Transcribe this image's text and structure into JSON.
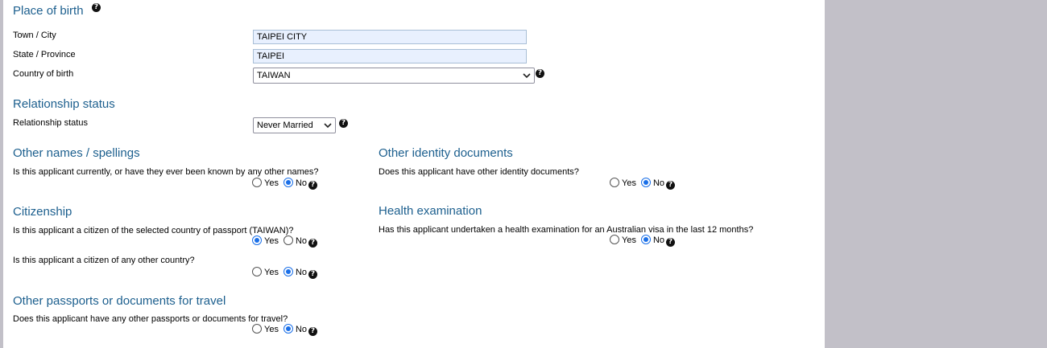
{
  "place_of_birth": {
    "heading": "Place of birth",
    "town_label": "Town / City",
    "town_value": "TAIPEI CITY",
    "state_label": "State / Province",
    "state_value": "TAIPEI",
    "country_label": "Country of birth",
    "country_value": "TAIWAN"
  },
  "relationship": {
    "heading": "Relationship status",
    "label": "Relationship status",
    "value": "Never Married"
  },
  "other_names": {
    "heading": "Other names / spellings",
    "question": "Is this applicant currently, or have they ever been known by any other names?",
    "yes": "Yes",
    "no": "No",
    "selected": "No"
  },
  "identity_docs": {
    "heading": "Other identity documents",
    "question": "Does this applicant have other identity documents?",
    "yes": "Yes",
    "no": "No",
    "selected": "No"
  },
  "citizenship": {
    "heading": "Citizenship",
    "q1": "Is this applicant a citizen of the selected country of passport (TAIWAN)?",
    "q1_selected": "Yes",
    "q2": "Is this applicant a citizen of any other country?",
    "q2_selected": "No",
    "yes": "Yes",
    "no": "No"
  },
  "health": {
    "heading": "Health examination",
    "question": "Has this applicant undertaken a health examination for an Australian visa in the last 12 months?",
    "yes": "Yes",
    "no": "No",
    "selected": "No"
  },
  "passports": {
    "heading": "Other passports or documents for travel",
    "question": "Does this applicant have any other passports or documents for travel?",
    "yes": "Yes",
    "no": "No",
    "selected": "No"
  },
  "icons": {
    "help": "?",
    "help_icon_name": "question-circle-icon",
    "chevron_icon_name": "chevron-down-icon"
  },
  "colors": {
    "heading": "#1c5f8e",
    "field_bg": "#e8f0fe",
    "radio_selected": "#1a6fe8",
    "side_panel": "#c2c0c8"
  }
}
